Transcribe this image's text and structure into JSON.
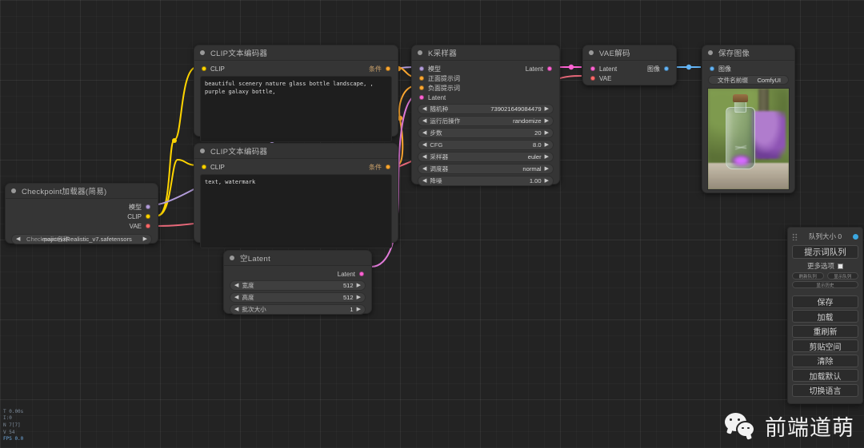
{
  "app": {
    "name": "ComfyUI"
  },
  "nodes": {
    "clip_positive": {
      "title": "CLIP文本编码器",
      "input_label": "CLIP",
      "output_label": "条件",
      "text": "beautiful scenery nature glass bottle landscape, , purple galaxy bottle,"
    },
    "clip_negative": {
      "title": "CLIP文本编码器",
      "input_label": "CLIP",
      "output_label": "条件",
      "text": "text, watermark"
    },
    "ksampler": {
      "title": "K采样器",
      "inputs": [
        "模型",
        "正面提示词",
        "负面提示词",
        "Latent"
      ],
      "output": "Latent",
      "widgets": [
        {
          "name": "随机种",
          "value": "739021649084479"
        },
        {
          "name": "运行后操作",
          "value": "randomize"
        },
        {
          "name": "步数",
          "value": "20"
        },
        {
          "name": "CFG",
          "value": "8.0"
        },
        {
          "name": "采样器",
          "value": "euler"
        },
        {
          "name": "调度器",
          "value": "normal"
        },
        {
          "name": "降噪",
          "value": "1.00"
        }
      ]
    },
    "vae_decode": {
      "title": "VAE解码",
      "inputs": [
        "Latent",
        "VAE"
      ],
      "output": "图像"
    },
    "save_image": {
      "title": "保存图像",
      "input_label": "图像",
      "widget": {
        "name": "文件名前缀",
        "value": "ComfyUI"
      }
    },
    "checkpoint_loader": {
      "title": "Checkpoint加载器(简易)",
      "outputs": [
        "模型",
        "CLIP",
        "VAE"
      ],
      "widget": {
        "name": "Checkpoint名称",
        "value": "majicmixRealistic_v7.safetensors"
      }
    },
    "empty_latent": {
      "title": "空Latent",
      "output": "Latent",
      "widgets": [
        {
          "name": "宽度",
          "value": "512"
        },
        {
          "name": "高度",
          "value": "512"
        },
        {
          "name": "批次大小",
          "value": "1"
        }
      ]
    }
  },
  "menu": {
    "queue_size_label": "队列大小 0",
    "queue_prompt": "提示词队列",
    "extra_options": "更多选项",
    "small_buttons": [
      "刷新队列",
      "显示队列"
    ],
    "history_button": "显示历史",
    "buttons": [
      "保存",
      "加载",
      "重刷新",
      "剪贴空间",
      "清除",
      "加载默认",
      "切换语言"
    ]
  },
  "debug": {
    "line1": "T 0.00s",
    "line2": "I:0",
    "line3": "N 7[7]",
    "line4": "V 54",
    "line5": "FPS 0.0"
  },
  "watermark": {
    "text": "前端道萌"
  },
  "colors": {
    "model": "#b39ddb",
    "clip": "#ffd500",
    "vae": "#ff6b6b",
    "conditioning": "#ffa931",
    "latent": "#ff64d4",
    "image": "#64b5f6",
    "accent": "#3ba7e0"
  },
  "arrows": {
    "left": "◀",
    "right": "▶"
  }
}
